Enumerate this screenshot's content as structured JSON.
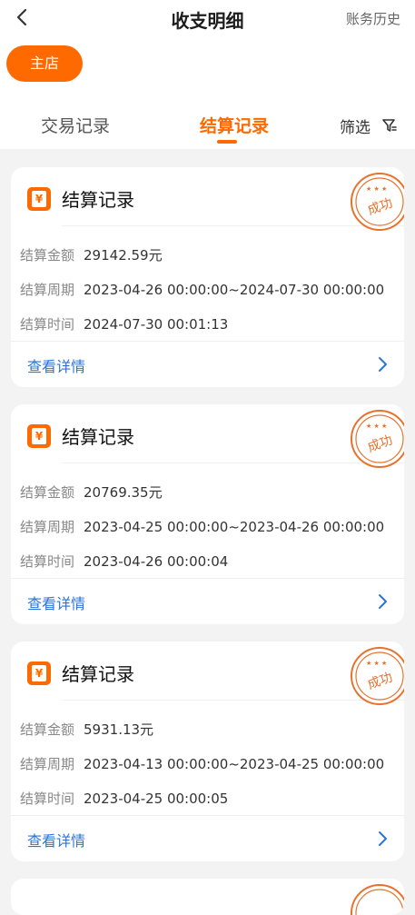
{
  "header": {
    "title": "收支明细",
    "history_label": "账务历史"
  },
  "shop": {
    "label": "主店"
  },
  "tabs": [
    {
      "label": "交易记录",
      "active": false
    },
    {
      "label": "结算记录",
      "active": true
    }
  ],
  "filter": {
    "label": "筛选"
  },
  "records": [
    {
      "title": "结算记录",
      "amount_label": "结算金额",
      "amount": "29142.59元",
      "period_label": "结算周期",
      "period": "2023-04-26 00:00:00~2024-07-30 00:00:00",
      "time_label": "结算时间",
      "time": "2024-07-30 00:01:13",
      "detail_label": "查看详情",
      "stamp_text": "成功"
    },
    {
      "title": "结算记录",
      "amount_label": "结算金额",
      "amount": "20769.35元",
      "period_label": "结算周期",
      "period": "2023-04-25 00:00:00~2023-04-26 00:00:00",
      "time_label": "结算时间",
      "time": "2023-04-26 00:00:04",
      "detail_label": "查看详情",
      "stamp_text": "成功"
    },
    {
      "title": "结算记录",
      "amount_label": "结算金额",
      "amount": "5931.13元",
      "period_label": "结算周期",
      "period": "2023-04-13 00:00:00~2023-04-25 00:00:00",
      "time_label": "结算时间",
      "time": "2023-04-25 00:00:05",
      "detail_label": "查看详情",
      "stamp_text": "成功"
    }
  ],
  "icons": {
    "back": "chevron-left-icon",
    "filter": "filter-icon",
    "record": "yen-icon",
    "stamp": "success-stamp-icon",
    "detail": "chevron-right-icon"
  },
  "colors": {
    "accent": "#ff6a00",
    "link": "#2a74d8",
    "stamp": "#e8712c"
  }
}
